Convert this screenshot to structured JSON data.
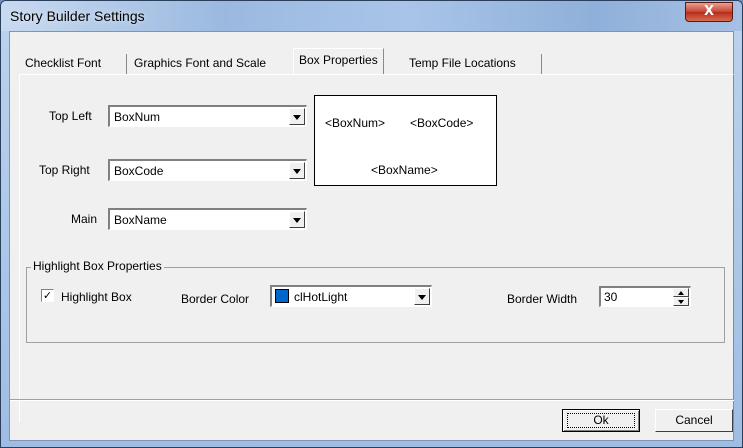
{
  "window": {
    "title": "Story Builder Settings",
    "close_glyph": "X"
  },
  "tabs": [
    {
      "label": "Checklist Font",
      "active": false
    },
    {
      "label": "Graphics Font and Scale",
      "active": false
    },
    {
      "label": "Box Properties",
      "active": true
    },
    {
      "label": "Temp File Locations",
      "active": false
    }
  ],
  "box_properties": {
    "top_left": {
      "label": "Top Left",
      "value": "BoxNum"
    },
    "top_right": {
      "label": "Top Right",
      "value": "BoxCode"
    },
    "main": {
      "label": "Main",
      "value": "BoxName"
    },
    "preview": {
      "top_left": "<BoxNum>",
      "top_right": "<BoxCode>",
      "main": "<BoxName>"
    }
  },
  "highlight": {
    "group_title": "Highlight Box Properties",
    "checkbox_label": "Highlight Box",
    "checked": true,
    "check_glyph": "✓",
    "border_color_label": "Border Color",
    "border_color_value": "clHotLight",
    "border_color_swatch": "#0066cc",
    "border_width_label": "Border Width",
    "border_width_value": "30"
  },
  "buttons": {
    "ok_label": "Ok",
    "cancel_label": "Cancel"
  },
  "icons": {
    "dropdown": "chevron-down-icon",
    "spin_up": "triangle-up-icon",
    "spin_down": "triangle-down-icon"
  }
}
